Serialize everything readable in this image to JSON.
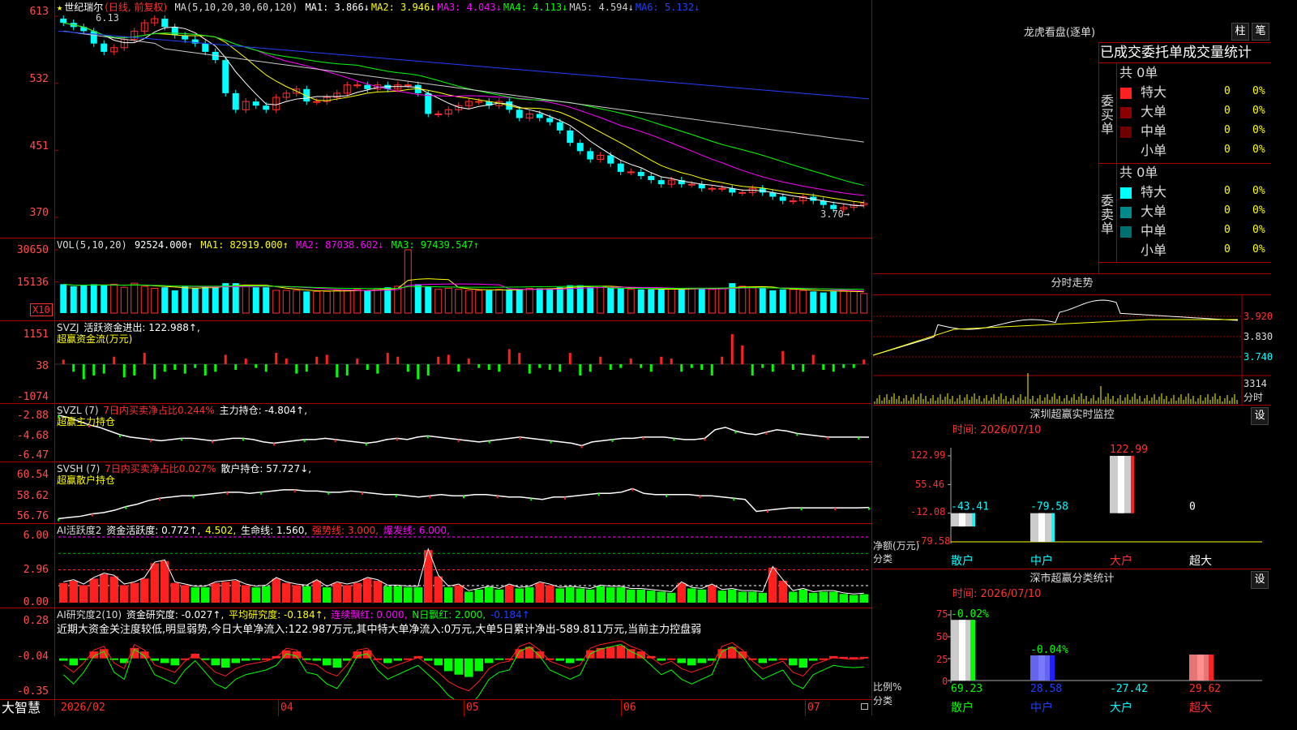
{
  "title": {
    "star": "★",
    "name": "世纪瑞尔",
    "period": "(日线, 前复权)"
  },
  "colors": {
    "up": "#ff3030",
    "down": "#00ffff",
    "green": "#00ff00",
    "red": "#ff2020",
    "grid": "#aa0000",
    "yellow": "#ffff00",
    "magenta": "#ff00ff",
    "blue": "#2040ff"
  },
  "main": {
    "ma_label": "MA(5,10,20,30,60,120)",
    "ma": [
      {
        "name": "MA1:",
        "value": "3.866↓",
        "color": "#ffffff"
      },
      {
        "name": "MA2:",
        "value": "3.946↓",
        "color": "#ffff00"
      },
      {
        "name": "MA3:",
        "value": "4.043↓",
        "color": "#ff00ff"
      },
      {
        "name": "MA4:",
        "value": "4.113↓",
        "color": "#00ff00"
      },
      {
        "name": "MA5:",
        "value": "4.594↓",
        "color": "#cccccc"
      },
      {
        "name": "MA6:",
        "value": "5.132↓",
        "color": "#2040ff"
      }
    ],
    "y_labels": [
      "613",
      "532",
      "451",
      "370"
    ],
    "high_mark": "6.13",
    "low_mark": "3.70→"
  },
  "vol": {
    "label": "VOL(5,10,20)",
    "value": "92524.000↑",
    "ma1": "MA1: 82919.000↑",
    "ma2": "MA2: 87038.602↓",
    "ma3": "MA3: 97439.547↑",
    "y_labels": [
      "30650",
      "15136"
    ],
    "unit": "X10"
  },
  "svzj": {
    "label": "SVZJ",
    "desc": "活跃资金进出: 122.988↑,",
    "sub": "超赢资金流(万元)",
    "y_labels": [
      "1151",
      "38",
      "-1074"
    ]
  },
  "svzl": {
    "label": "SVZL (7)",
    "desc": "7日内买卖净占比0.244%",
    "extra": "主力持仓: -4.804↑,",
    "sub": "超赢主力持仓",
    "y_labels": [
      "-2.88",
      "-4.68",
      "-6.47"
    ]
  },
  "svsh": {
    "label": "SVSH (7)",
    "desc": "7日内买卖净占比0.027%",
    "extra": "散户持仓: 57.727↓,",
    "sub": "超赢散户持仓",
    "y_labels": [
      "60.54",
      "58.62",
      "56.76"
    ]
  },
  "ai1": {
    "label": "AI活跃度2",
    "a": "资金活跃度: 0.772↑,",
    "b": "4.502,",
    "c": "生命线: 1.560,",
    "d": "强势线: 3.000,",
    "e": "爆发线: 6.000,",
    "y_labels": [
      "6.00",
      "2.96",
      "0.00"
    ]
  },
  "ai2": {
    "label": "AI研究度2(10)",
    "a": "资金研究度: -0.027↑,",
    "b": "平均研究度: -0.184↑,",
    "c": "连续飘红: 0.000,",
    "d": "N日飘红: 2.000,",
    "e": "-0.184↑",
    "note": "近期大资金关注度较低,明显弱势,今日大单净流入:122.987万元,其中特大单净流入:0万元,大单5日累计净出-589.811万元,当前主力控盘弱",
    "y_labels": [
      "0.28",
      "-0.04",
      "-0.35"
    ]
  },
  "xaxis": {
    "brand": "大智慧",
    "ticks": [
      "2026/02",
      "04",
      "05",
      "06",
      "07"
    ]
  },
  "right": {
    "lhb_title": "龙虎看盘(逐单)",
    "tab_bar": "柱",
    "tab_pen": "笔",
    "table_title": "已成交委托单成交量统计",
    "buy": {
      "side": "委买单",
      "total": "共 0单",
      "rows": [
        {
          "label": "特大",
          "val": "0",
          "pct": "0%",
          "color": "#ff2020"
        },
        {
          "label": "大单",
          "val": "0",
          "pct": "0%",
          "color": "#8b0000"
        },
        {
          "label": "中单",
          "val": "0",
          "pct": "0%",
          "color": "#700000"
        },
        {
          "label": "小单",
          "val": "0",
          "pct": "0%",
          "color": ""
        }
      ]
    },
    "sell": {
      "side": "委卖单",
      "total": "共 0单",
      "rows": [
        {
          "label": "特大",
          "val": "0",
          "pct": "0%",
          "color": "#00ffff"
        },
        {
          "label": "大单",
          "val": "0",
          "pct": "0%",
          "color": "#008b8b"
        },
        {
          "label": "中单",
          "val": "0",
          "pct": "0%",
          "color": "#006f6f"
        },
        {
          "label": "小单",
          "val": "0",
          "pct": "0%",
          "color": ""
        }
      ]
    },
    "intraday_title": "分时走势",
    "intraday_y": [
      "3.920",
      "3.830",
      "3.740"
    ],
    "intraday_vol": "3314",
    "intraday_vol_unit": "分时",
    "mon_title": "深圳超赢实时监控",
    "mon_set": "设",
    "mon_time": "时间: 2026/07/10",
    "mon_y": [
      "122.99",
      "55.46",
      "-12.08",
      "-79.58"
    ],
    "mon_ylabel": "净额(万元)",
    "mon_xlabel": "分类",
    "mon_bars": [
      {
        "cat": "散户",
        "val": -43.41,
        "label": "-43.41"
      },
      {
        "cat": "中户",
        "val": -79.58,
        "label": "-79.58"
      },
      {
        "cat": "大户",
        "val": 122.99,
        "label": "122.99"
      },
      {
        "cat": "超大",
        "val": 0,
        "label": "0"
      }
    ],
    "stat_title": "深市超赢分类统计",
    "stat_set": "设",
    "stat_time": "时间: 2026/07/10",
    "stat_y": [
      "75",
      "50",
      "25",
      "0"
    ],
    "stat_ylabel": "比例%",
    "stat_xlabel": "分类",
    "stat_bars": [
      {
        "cat": "散户",
        "val": 69.23,
        "label": "69.23",
        "top": "-0.02%",
        "color": "#00ff00"
      },
      {
        "cat": "中户",
        "val": 28.58,
        "label": "28.58",
        "top": "-0.04%",
        "color": "#2020ff"
      },
      {
        "cat": "大户",
        "val": -27.42,
        "label": "-27.42",
        "top": "",
        "color": "#ff2020"
      },
      {
        "cat": "超大",
        "val": 29.62,
        "label": "29.62",
        "top": "",
        "color": "#ff2020"
      }
    ]
  },
  "chart_data": [
    {
      "type": "candlestick",
      "title": "世纪瑞尔 (日线, 前复权)",
      "ylim": [
        3.7,
        6.13
      ],
      "y_ticks": [
        6.13,
        5.32,
        4.51,
        3.7
      ],
      "x": [
        "2026/02",
        "04",
        "05",
        "06",
        "07"
      ],
      "close": [
        6.05,
        6.0,
        5.95,
        5.8,
        5.7,
        5.75,
        5.85,
        5.95,
        6.05,
        6.1,
        6.0,
        5.9,
        5.85,
        5.8,
        5.7,
        5.6,
        5.2,
        5.0,
        5.1,
        5.05,
        5.0,
        5.15,
        5.2,
        5.25,
        5.1,
        5.1,
        5.15,
        5.2,
        5.3,
        5.3,
        5.25,
        5.3,
        5.25,
        5.3,
        5.3,
        5.2,
        4.95,
        4.95,
        5.0,
        5.05,
        5.1,
        5.1,
        5.05,
        5.1,
        5.0,
        4.9,
        4.95,
        4.9,
        4.85,
        4.75,
        4.6,
        4.5,
        4.4,
        4.45,
        4.35,
        4.25,
        4.25,
        4.2,
        4.15,
        4.1,
        4.15,
        4.1,
        4.1,
        4.05,
        4.05,
        4.05,
        4.0,
        4.0,
        4.05,
        4.0,
        3.95,
        3.9,
        3.9,
        3.95,
        3.9,
        3.85,
        3.8,
        3.82,
        3.85,
        3.87
      ],
      "series": [
        {
          "name": "MA1",
          "value": 3.866
        },
        {
          "name": "MA2",
          "value": 3.946
        },
        {
          "name": "MA3",
          "value": 4.043
        },
        {
          "name": "MA4",
          "value": 4.113
        },
        {
          "name": "MA5",
          "value": 4.594
        },
        {
          "name": "MA6",
          "value": 5.132
        }
      ]
    },
    {
      "type": "bar",
      "title": "VOL(5,10,20)",
      "ylim": [
        0,
        30650
      ],
      "values": [
        14000,
        13000,
        13500,
        14000,
        13500,
        14000,
        12500,
        14500,
        13000,
        12000,
        12500,
        11000,
        13000,
        12000,
        13000,
        12500,
        14500,
        14500,
        13500,
        12500,
        12500,
        11000,
        11000,
        11000,
        10500,
        10500,
        10500,
        11000,
        11000,
        11500,
        11000,
        12000,
        12500,
        13000,
        30650,
        14000,
        13000,
        11500,
        12000,
        11500,
        11000,
        11000,
        11000,
        11500,
        11500,
        11500,
        12000,
        12000,
        12000,
        12500,
        13500,
        13500,
        12500,
        13000,
        12500,
        12000,
        11500,
        11500,
        11500,
        11500,
        12000,
        11500,
        12000,
        12000,
        11500,
        12000,
        14500,
        13000,
        12500,
        12000,
        11000,
        11500,
        11500,
        11000,
        10500,
        10000,
        10500,
        11000,
        10500,
        9500
      ]
    },
    {
      "type": "bar",
      "title": "SVZJ 超赢资金流(万元)",
      "ylim": [
        -1074,
        1151
      ],
      "values": [
        120,
        -200,
        -400,
        -300,
        -250,
        200,
        -350,
        -300,
        300,
        -400,
        -200,
        -150,
        -250,
        -100,
        -300,
        -200,
        250,
        -150,
        150,
        -100,
        -200,
        300,
        150,
        -250,
        -200,
        200,
        250,
        -350,
        -300,
        150,
        -150,
        -250,
        300,
        200,
        -200,
        -400,
        -300,
        200,
        250,
        -200,
        150,
        -100,
        -150,
        -200,
        400,
        300,
        -250,
        -100,
        -150,
        -200,
        300,
        -300,
        -200,
        200,
        -150,
        -100,
        150,
        -100,
        -200,
        200,
        150,
        -200,
        -100,
        -150,
        -300,
        200,
        800,
        500,
        -300,
        -100,
        -200,
        350,
        -150,
        -200,
        250,
        -150,
        -200,
        -100,
        -100,
        122.988
      ]
    },
    {
      "type": "line",
      "title": "SVZL 超赢主力持仓",
      "ylim": [
        -6.47,
        -2.88
      ],
      "values": [
        -3.0,
        -3.2,
        -3.5,
        -3.8,
        -4.0,
        -4.3,
        -4.6,
        -4.8,
        -4.9,
        -5.0,
        -5.1,
        -5.0,
        -4.9,
        -4.9,
        -5.0,
        -5.1,
        -5.0,
        -4.9,
        -4.9,
        -5.0,
        -5.2,
        -5.3,
        -5.2,
        -5.1,
        -5.0,
        -5.0,
        -4.9,
        -5.0,
        -5.1,
        -5.2,
        -5.3,
        -5.2,
        -5.0,
        -4.9,
        -5.0,
        -4.8,
        -4.7,
        -4.8,
        -4.9,
        -5.0,
        -5.1,
        -5.2,
        -5.1,
        -5.0,
        -4.9,
        -4.8,
        -4.9,
        -5.0,
        -5.1,
        -5.2,
        -5.3,
        -5.5,
        -5.2,
        -5.1,
        -5.0,
        -4.9,
        -4.9,
        -4.8,
        -4.8,
        -4.8,
        -4.9,
        -5.0,
        -5.0,
        -4.9,
        -4.2,
        -4.0,
        -4.3,
        -4.5,
        -4.6,
        -4.4,
        -4.2,
        -4.3,
        -4.5,
        -4.6,
        -4.7,
        -4.8,
        -4.8,
        -4.8,
        -4.8,
        -4.804
      ]
    },
    {
      "type": "line",
      "title": "SVSH 超赢散户持仓",
      "ylim": [
        56.76,
        60.54
      ],
      "values": [
        56.8,
        56.9,
        57.0,
        57.2,
        57.3,
        57.5,
        57.8,
        58.0,
        58.3,
        58.5,
        58.6,
        58.7,
        58.7,
        58.8,
        58.9,
        59.0,
        59.0,
        58.9,
        59.0,
        59.1,
        59.2,
        59.2,
        59.1,
        59.1,
        59.0,
        59.0,
        59.1,
        59.0,
        58.9,
        58.8,
        58.8,
        58.7,
        58.6,
        58.7,
        58.8,
        58.7,
        58.7,
        58.8,
        58.8,
        58.7,
        58.6,
        58.6,
        58.5,
        58.4,
        58.6,
        58.6,
        58.7,
        58.8,
        58.9,
        58.9,
        59.0,
        59.3,
        58.9,
        58.8,
        58.8,
        58.8,
        58.8,
        58.7,
        58.7,
        58.6,
        58.5,
        58.4,
        57.4,
        57.5,
        57.6,
        57.7,
        57.7,
        57.7,
        57.7,
        57.7,
        57.7,
        57.7,
        57.727
      ]
    },
    {
      "type": "bar",
      "title": "AI活跃度2",
      "ylim": [
        0,
        6
      ],
      "values": [
        1.8,
        2.0,
        1.6,
        2.2,
        2.6,
        2.4,
        1.6,
        1.8,
        2.2,
        3.6,
        3.8,
        1.8,
        1.6,
        1.4,
        1.4,
        1.8,
        1.9,
        2.0,
        1.6,
        1.4,
        1.5,
        2.2,
        1.8,
        1.6,
        1.5,
        2.0,
        1.4,
        1.8,
        1.6,
        1.8,
        2.2,
        2.0,
        1.5,
        1.5,
        1.4,
        1.4,
        4.8,
        2.4,
        1.4,
        1.6,
        1.0,
        1.2,
        1.4,
        1.2,
        1.6,
        1.3,
        1.4,
        1.8,
        1.6,
        1.3,
        1.4,
        1.3,
        1.2,
        1.5,
        1.4,
        1.4,
        1.2,
        1.2,
        1.1,
        1.0,
        0.9,
        1.8,
        1.3,
        1.2,
        1.6,
        1.1,
        1.2,
        1.0,
        1.0,
        0.9,
        3.2,
        2.0,
        1.0,
        1.2,
        0.9,
        1.0,
        1.0,
        0.8,
        0.7,
        0.772
      ]
    },
    {
      "type": "bar",
      "title": "AI研究度2(10)",
      "ylim": [
        -0.35,
        0.28
      ],
      "values": [
        -0.06,
        -0.1,
        -0.05,
        0.02,
        0.04,
        -0.05,
        -0.08,
        0.05,
        0.02,
        -0.06,
        -0.08,
        -0.1,
        -0.04,
        0.0,
        -0.05,
        -0.1,
        -0.12,
        -0.08,
        -0.06,
        -0.05,
        -0.04,
        -0.02,
        0.03,
        0.02,
        -0.05,
        -0.06,
        -0.1,
        -0.12,
        -0.06,
        0.02,
        0.03,
        -0.04,
        -0.08,
        -0.06,
        -0.04,
        -0.02,
        -0.06,
        -0.1,
        -0.15,
        -0.18,
        -0.2,
        -0.15,
        -0.08,
        -0.05,
        -0.04,
        0.04,
        0.06,
        0.02,
        -0.04,
        -0.06,
        -0.08,
        -0.06,
        0.03,
        0.05,
        0.06,
        0.07,
        0.04,
        0.02,
        -0.02,
        -0.06,
        -0.04,
        -0.08,
        -0.1,
        -0.08,
        -0.06,
        0.04,
        0.06,
        0.02,
        -0.04,
        -0.08,
        -0.06,
        -0.04,
        -0.1,
        -0.12,
        -0.06,
        -0.04,
        -0.02,
        -0.027,
        -0.03,
        -0.027
      ]
    }
  ]
}
